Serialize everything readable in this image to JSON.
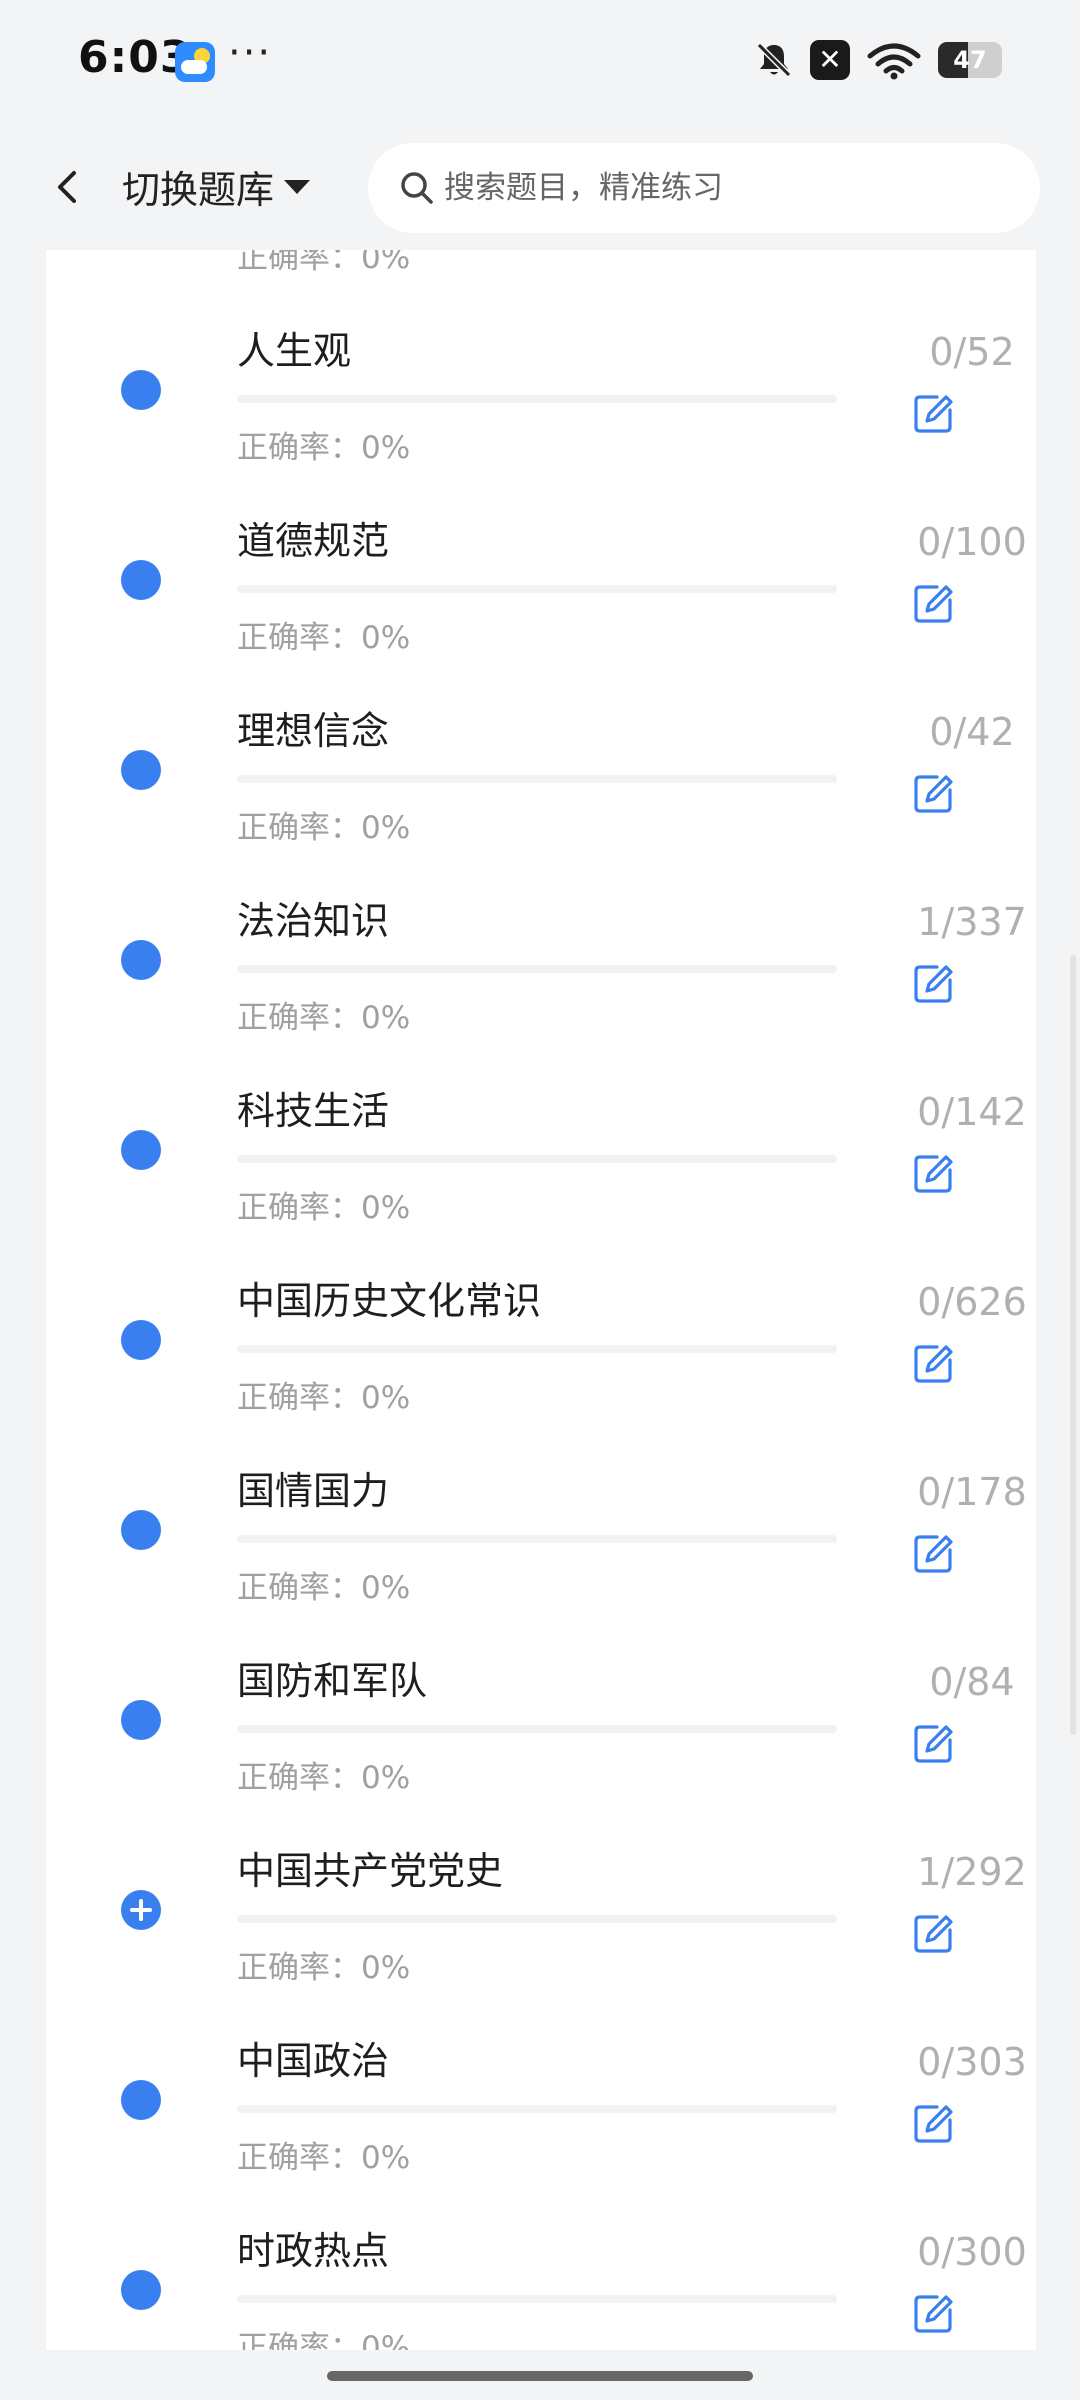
{
  "status_bar": {
    "time": "6:03",
    "more": "···",
    "battery": "47"
  },
  "header": {
    "switch_label": "切换题库",
    "search_placeholder": "搜索题目，精准练习"
  },
  "accuracy_prefix": "正确率：",
  "list": [
    {
      "title": "",
      "accuracy": "0%",
      "count": ""
    },
    {
      "title": "人生观",
      "accuracy": "0%",
      "count": "0/52"
    },
    {
      "title": "道德规范",
      "accuracy": "0%",
      "count": "0/100"
    },
    {
      "title": "理想信念",
      "accuracy": "0%",
      "count": "0/42"
    },
    {
      "title": "法治知识",
      "accuracy": "0%",
      "count": "1/337"
    },
    {
      "title": "科技生活",
      "accuracy": "0%",
      "count": "0/142"
    },
    {
      "title": "中国历史文化常识",
      "accuracy": "0%",
      "count": "0/626"
    },
    {
      "title": "国情国力",
      "accuracy": "0%",
      "count": "0/178"
    },
    {
      "title": "国防和军队",
      "accuracy": "0%",
      "count": "0/84"
    },
    {
      "title": "中国共产党党史",
      "accuracy": "0%",
      "count": "1/292"
    },
    {
      "title": "中国政治",
      "accuracy": "0%",
      "count": "0/303"
    },
    {
      "title": "时政热点",
      "accuracy": "0%",
      "count": "0/300"
    }
  ],
  "colors": {
    "accent": "#3a7ff0",
    "count_gray": "#b0b0b0",
    "background": "#f3f4f6"
  },
  "icons": {
    "back": "chevron-left-icon",
    "search": "search-icon",
    "edit": "edit-icon",
    "expand": "plus-circle-icon"
  }
}
